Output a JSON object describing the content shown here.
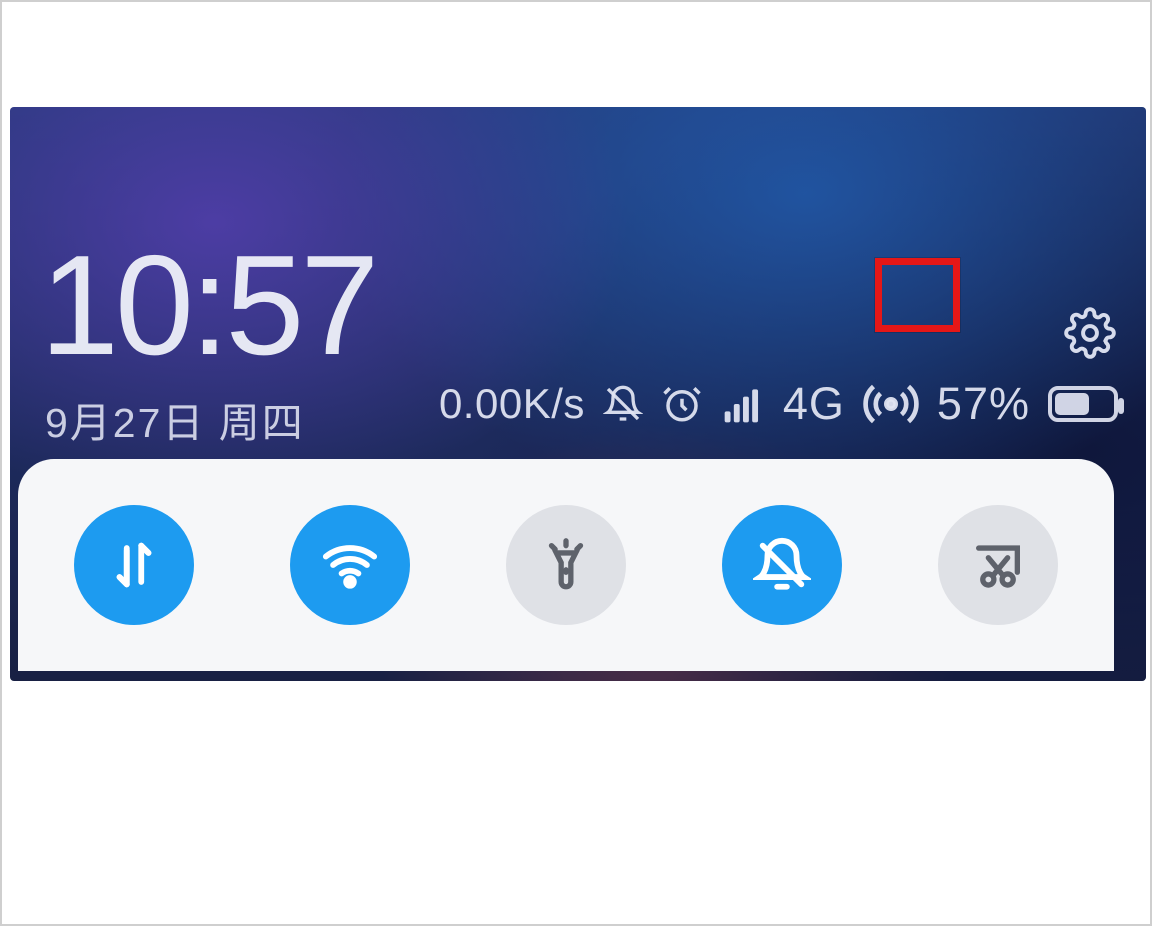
{
  "clock": {
    "time": "10:57",
    "date": "9月27日 周四"
  },
  "status": {
    "net_speed": "0.00K/s",
    "network_label": "4G",
    "battery_percent": "57%",
    "battery_level": 0.57,
    "mute_icon": "bell-slash",
    "alarm_icon": "alarm-clock",
    "signal_icon": "cellular-signal",
    "hotspot_icon": "hotspot",
    "hotspot_highlighted": true
  },
  "settings_icon": "gear",
  "toggles": [
    {
      "name": "mobile-data",
      "icon": "data-arrows",
      "active": true
    },
    {
      "name": "wifi",
      "icon": "wifi",
      "active": true
    },
    {
      "name": "flashlight",
      "icon": "flashlight",
      "active": false
    },
    {
      "name": "do-not-disturb",
      "icon": "bell-slash",
      "active": true
    },
    {
      "name": "screenshot",
      "icon": "scissors-crop",
      "active": false
    }
  ],
  "colors": {
    "toggle_active": "#1d9bf0",
    "toggle_inactive": "#dfe1e6",
    "highlight": "#e51717"
  }
}
